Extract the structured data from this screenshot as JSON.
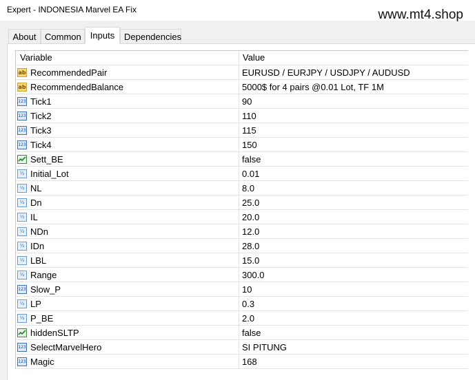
{
  "window": {
    "title": "Expert - INDONESIA Marvel EA Fix",
    "watermark": "www.mt4.shop"
  },
  "tabs": [
    {
      "label": "About",
      "active": false
    },
    {
      "label": "Common",
      "active": false
    },
    {
      "label": "Inputs",
      "active": true
    },
    {
      "label": "Dependencies",
      "active": false
    }
  ],
  "table": {
    "headers": {
      "variable": "Variable",
      "value": "Value"
    },
    "rows": [
      {
        "variable": "RecommendedPair",
        "value": "EURUSD / EURJPY / USDJPY / AUDUSD",
        "icon": "string-icon"
      },
      {
        "variable": "RecommendedBalance",
        "value": "5000$ for 4 pairs @0.01 Lot, TF 1M",
        "icon": "string-icon"
      },
      {
        "variable": "Tick1",
        "value": "90",
        "icon": "integer-icon"
      },
      {
        "variable": "Tick2",
        "value": "110",
        "icon": "integer-icon"
      },
      {
        "variable": "Tick3",
        "value": "115",
        "icon": "integer-icon"
      },
      {
        "variable": "Tick4",
        "value": "150",
        "icon": "integer-icon"
      },
      {
        "variable": "Sett_BE",
        "value": "false",
        "icon": "boolean-icon"
      },
      {
        "variable": "Initial_Lot",
        "value": "0.01",
        "icon": "double-icon"
      },
      {
        "variable": "NL",
        "value": "8.0",
        "icon": "double-icon"
      },
      {
        "variable": "Dn",
        "value": "25.0",
        "icon": "double-icon"
      },
      {
        "variable": "IL",
        "value": "20.0",
        "icon": "double-icon"
      },
      {
        "variable": "NDn",
        "value": "12.0",
        "icon": "double-icon"
      },
      {
        "variable": "IDn",
        "value": "28.0",
        "icon": "double-icon"
      },
      {
        "variable": "LBL",
        "value": "15.0",
        "icon": "double-icon"
      },
      {
        "variable": "Range",
        "value": "300.0",
        "icon": "double-icon"
      },
      {
        "variable": "Slow_P",
        "value": "10",
        "icon": "integer-icon"
      },
      {
        "variable": "LP",
        "value": "0.3",
        "icon": "double-icon"
      },
      {
        "variable": "P_BE",
        "value": "2.0",
        "icon": "double-icon"
      },
      {
        "variable": "hiddenSLTP",
        "value": "false",
        "icon": "boolean-icon"
      },
      {
        "variable": "SelectMarvelHero",
        "value": "SI PITUNG",
        "icon": "integer-icon"
      },
      {
        "variable": "Magic",
        "value": "168",
        "icon": "integer-icon"
      }
    ]
  }
}
